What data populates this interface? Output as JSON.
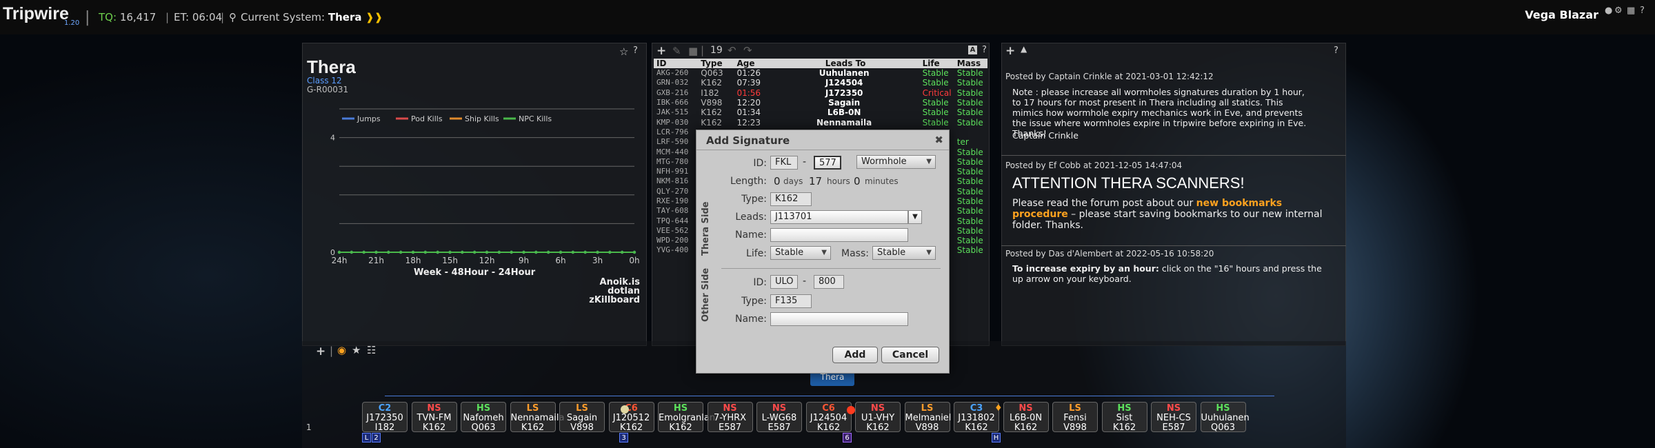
{
  "app": {
    "title": "Tripwire",
    "version": "1.20",
    "tq_label": "TQ:",
    "tq_value": "16,417",
    "et_label": "ET:",
    "et_value": "06:04",
    "current_system_label": "Current System:",
    "current_system": "Thera",
    "user": "Vega Blazar"
  },
  "system": {
    "name": "Thera",
    "class": "Class 12",
    "region": "G-R00031",
    "links": [
      "Anoik.is",
      "dotlan",
      "zKillboard"
    ]
  },
  "chart_data": {
    "type": "line",
    "legend": [
      "Jumps",
      "Pod Kills",
      "Ship Kills",
      "NPC Kills"
    ],
    "categories": [
      "24h",
      "21h",
      "18h",
      "15h",
      "12h",
      "9h",
      "6h",
      "3h",
      "0h"
    ],
    "yticks": [
      "0",
      "4"
    ],
    "ylim": [
      0,
      5
    ],
    "xlabel": "Week - 48Hour - 24Hour",
    "series": [
      {
        "name": "Jumps",
        "values": [
          0,
          0,
          0,
          0,
          0,
          0,
          0,
          0,
          0,
          0,
          0,
          0,
          0,
          0,
          0,
          0,
          0,
          0,
          0,
          0,
          0,
          0,
          0,
          0,
          0
        ]
      },
      {
        "name": "NPC Kills",
        "values": [
          0,
          0,
          0,
          0,
          0,
          0,
          0,
          0,
          0,
          0,
          0,
          0,
          0,
          0,
          0,
          0,
          0,
          0,
          0,
          0,
          0,
          0,
          0,
          0,
          0
        ]
      }
    ],
    "colors": {
      "Jumps": "#4a7bd8",
      "Pod Kills": "#d84a4a",
      "Ship Kills": "#e08a2c",
      "NPC Kills": "#4ab84a"
    }
  },
  "sig": {
    "count": "19",
    "headers": [
      "ID",
      "Type",
      "Age",
      "Leads To",
      "Life",
      "Mass"
    ],
    "rows": [
      {
        "id": "AKG-260",
        "type": "Q063",
        "age": "01:26",
        "leads": "Uuhulanen",
        "life": "Stable",
        "mass": "Stable",
        "crit": false
      },
      {
        "id": "GRN-032",
        "type": "K162",
        "age": "07:39",
        "leads": "J124504",
        "life": "Stable",
        "mass": "Stable",
        "crit": false
      },
      {
        "id": "GXB-216",
        "type": "I182",
        "age": "01:56",
        "leads": "J172350",
        "life": "Critical",
        "mass": "Stable",
        "crit": true
      },
      {
        "id": "IBK-666",
        "type": "V898",
        "age": "12:20",
        "leads": "Sagain",
        "life": "Stable",
        "mass": "Stable",
        "crit": false
      },
      {
        "id": "JAK-515",
        "type": "K162",
        "age": "01:34",
        "leads": "L6B-0N",
        "life": "Stable",
        "mass": "Stable",
        "crit": false
      },
      {
        "id": "KMP-030",
        "type": "K162",
        "age": "12:23",
        "leads": "Nennamaila",
        "life": "Stable",
        "mass": "Stable",
        "crit": false
      },
      {
        "id": "LCR-796",
        "type": "",
        "age": "",
        "leads": "",
        "life": "",
        "mass": "",
        "crit": false
      },
      {
        "id": "LRF-590",
        "type": "",
        "age": "",
        "leads": "",
        "life": "",
        "mass": "ter",
        "crit": false
      },
      {
        "id": "MCM-440",
        "type": "",
        "age": "",
        "leads": "",
        "life": "",
        "mass": "Stable",
        "crit": false
      },
      {
        "id": "MTG-780",
        "type": "",
        "age": "",
        "leads": "",
        "life": "",
        "mass": "Stable",
        "crit": false
      },
      {
        "id": "NFH-991",
        "type": "",
        "age": "",
        "leads": "",
        "life": "",
        "mass": "Stable",
        "crit": false
      },
      {
        "id": "NKM-816",
        "type": "",
        "age": "",
        "leads": "",
        "life": "",
        "mass": "Stable",
        "crit": false
      },
      {
        "id": "QLY-270",
        "type": "",
        "age": "",
        "leads": "",
        "life": "",
        "mass": "Stable",
        "crit": false
      },
      {
        "id": "RXE-190",
        "type": "",
        "age": "",
        "leads": "",
        "life": "",
        "mass": "Stable",
        "crit": false
      },
      {
        "id": "TAY-608",
        "type": "",
        "age": "",
        "leads": "",
        "life": "",
        "mass": "Stable",
        "crit": false
      },
      {
        "id": "TPQ-644",
        "type": "",
        "age": "",
        "leads": "",
        "life": "",
        "mass": "Stable",
        "crit": false
      },
      {
        "id": "VEE-562",
        "type": "",
        "age": "",
        "leads": "",
        "life": "",
        "mass": "Stable",
        "crit": false
      },
      {
        "id": "WPD-200",
        "type": "",
        "age": "",
        "leads": "",
        "life": "",
        "mass": "Stable",
        "crit": false
      },
      {
        "id": "YVG-400",
        "type": "",
        "age": "",
        "leads": "",
        "life": "",
        "mass": "Stable",
        "crit": false
      }
    ]
  },
  "notes": [
    {
      "meta": "Posted by Captain Crinkle at 2021-03-01 12:42:12",
      "body": "Note : please increase all wormholes signatures duration by 1 hour, to 17 hours for most present in Thera including all statics. This mimics how wormhole expiry mechanics work in Eve, and prevents the issue where wormholes expire in tripwire before expiring in Eve. Thanks!",
      "sign": "Captain Crinkle"
    },
    {
      "meta": "Posted by Ef Cobb at 2021-12-05 14:47:04",
      "title": "ATTENTION THERA SCANNERS!",
      "pre": "Please read the forum post about our ",
      "link": "new bookmarks procedure",
      "post": " – please start saving bookmarks to our new internal folder. Thanks."
    },
    {
      "meta": "Posted by Das d'Alembert at 2022-05-16 10:58:20",
      "bold": "To increase expiry by an hour:",
      "body": " click on the \"16\" hours and press the up arrow on your keyboard."
    }
  ],
  "dialog": {
    "title": "Add Signature",
    "id_label": "ID:",
    "id_prefix": "FKL",
    "id_sep": "-",
    "id_suffix": "577",
    "sig_type": "Wormhole",
    "length_label": "Length:",
    "days": "0",
    "days_lbl": "days",
    "hours": "17",
    "hours_lbl": "hours",
    "minutes": "0",
    "minutes_lbl": "minutes",
    "type_label": "Type:",
    "type": "K162",
    "leads_label": "Leads:",
    "leads": "J113701",
    "name_label": "Name:",
    "life_label": "Life:",
    "life": "Stable",
    "mass_label": "Mass:",
    "mass": "Stable",
    "thera_side": "Thera Side",
    "other_side": "Other Side",
    "other_id_prefix": "ULO",
    "other_id_suffix": "800",
    "other_type": "F135",
    "add": "Add",
    "cancel": "Cancel"
  },
  "map": {
    "row_label": "1",
    "center": "Thera",
    "nodes": [
      {
        "cls": "C2",
        "name": "J172350",
        "static": "I182"
      },
      {
        "cls": "NS",
        "name": "TVN-FM",
        "static": "K162"
      },
      {
        "cls": "HS",
        "name": "Nafomeh",
        "static": "Q063"
      },
      {
        "cls": "LS",
        "name": "Nennamaila",
        "static": "K162"
      },
      {
        "cls": "LS",
        "name": "Sagain",
        "static": "V898"
      },
      {
        "cls": "C6",
        "name": "J120512",
        "static": "K162"
      },
      {
        "cls": "HS",
        "name": "Emolgranlan",
        "static": "K162"
      },
      {
        "cls": "NS",
        "name": "7-YHRX",
        "static": "E587"
      },
      {
        "cls": "NS",
        "name": "L-WG68",
        "static": "E587"
      },
      {
        "cls": "C6",
        "name": "J124504",
        "static": "K162"
      },
      {
        "cls": "NS",
        "name": "U1-VHY",
        "static": "K162"
      },
      {
        "cls": "LS",
        "name": "Melmaniel",
        "static": "V898"
      },
      {
        "cls": "C3",
        "name": "J131802",
        "static": "K162"
      },
      {
        "cls": "NS",
        "name": "L6B-0N",
        "static": "K162"
      },
      {
        "cls": "LS",
        "name": "Fensi",
        "static": "V898"
      },
      {
        "cls": "HS",
        "name": "Sist",
        "static": "K162"
      },
      {
        "cls": "NS",
        "name": "NEH-CS",
        "static": "E587"
      },
      {
        "cls": "HS",
        "name": "Uuhulanen",
        "static": "Q063"
      }
    ],
    "tags": [
      "L",
      "2",
      "3",
      "6",
      "H"
    ]
  }
}
